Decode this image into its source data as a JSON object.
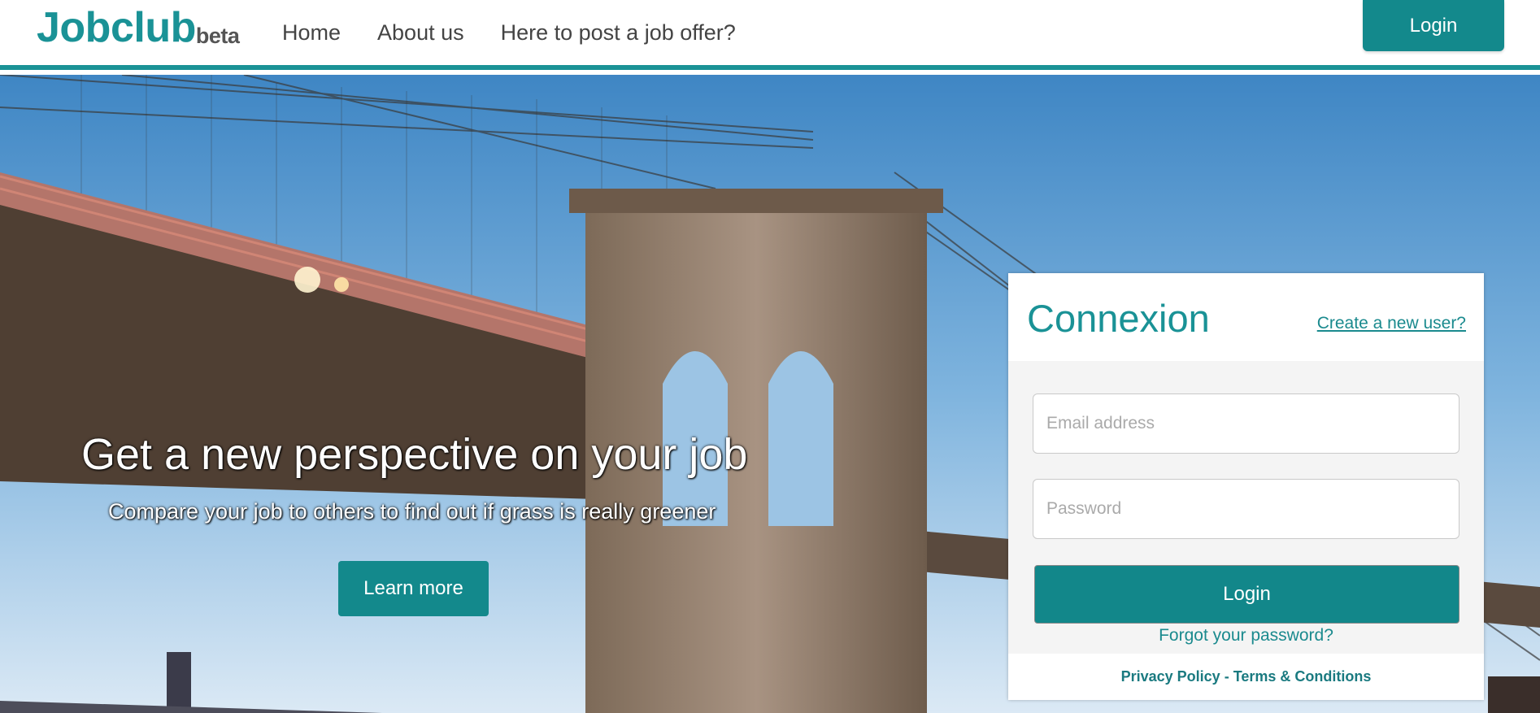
{
  "header": {
    "logo": "Jobclub",
    "logo_suffix": "beta",
    "nav": [
      "Home",
      "About us",
      "Here to post a job offer?"
    ],
    "login_label": "Login"
  },
  "hero": {
    "title": "Get a new perspective on your job",
    "subtitle": "Compare your job to others to find out if grass is really greener",
    "cta_label": "Learn more"
  },
  "login_panel": {
    "title": "Connexion",
    "create_user_link": "Create a new user?",
    "email_placeholder": "Email address",
    "password_placeholder": "Password",
    "submit_label": "Login",
    "forgot_link": "Forgot your password?",
    "privacy_link": "Privacy Policy",
    "separator": "-",
    "terms_link": "Terms & Conditions"
  },
  "colors": {
    "accent": "#1a9296",
    "button": "#13898c"
  }
}
